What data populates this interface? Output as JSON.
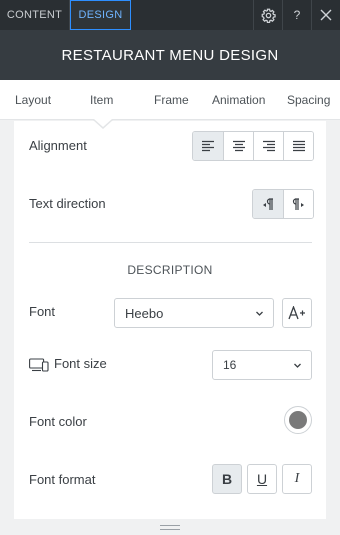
{
  "topbar": {
    "tabs": [
      "CONTENT",
      "DESIGN"
    ],
    "icons": [
      "gear-icon",
      "help-icon",
      "close-icon"
    ],
    "help_label": "?"
  },
  "title": "RESTAURANT MENU DESIGN",
  "subtabs": [
    "Layout",
    "Item",
    "Frame",
    "Animation",
    "Spacing"
  ],
  "active_subtab": "Item",
  "settings": {
    "alignment_label": "Alignment",
    "text_direction_label": "Text direction",
    "section_title": "DESCRIPTION",
    "font_label": "Font",
    "font_value": "Heebo",
    "font_size_label": "Font size",
    "font_size_value": "16",
    "font_color_label": "Font color",
    "font_color_value": "#7a7a7a",
    "font_format_label": "Font format",
    "format_bold": "B",
    "format_underline": "U",
    "format_italic": "I"
  },
  "colors": {
    "accent": "#2e8fff",
    "topbar": "#2a2f33",
    "titlebar": "#363c41"
  }
}
